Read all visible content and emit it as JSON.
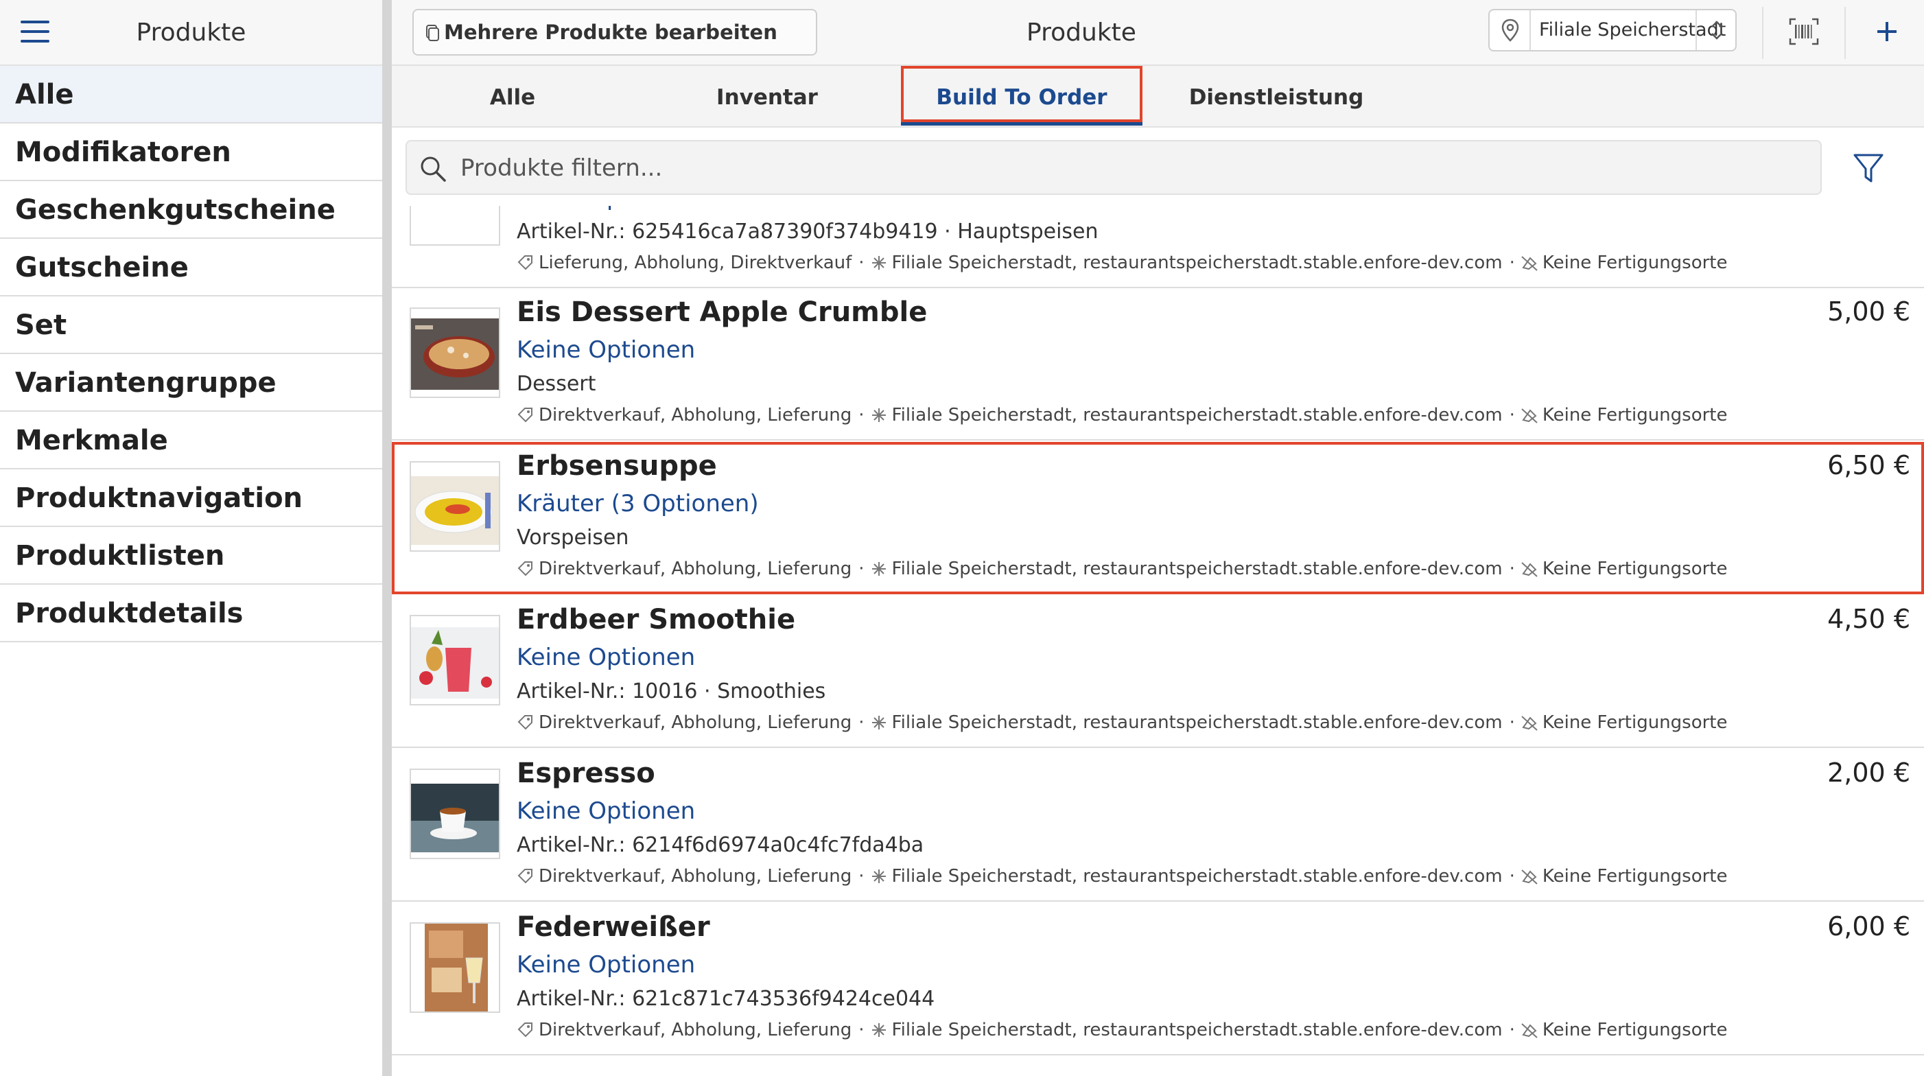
{
  "sidebar": {
    "title": "Produkte",
    "items": [
      {
        "label": "Alle",
        "active": true
      },
      {
        "label": "Modifikatoren"
      },
      {
        "label": "Geschenkgutscheine"
      },
      {
        "label": "Gutscheine"
      },
      {
        "label": "Set"
      },
      {
        "label": "Variantengruppe"
      },
      {
        "label": "Merkmale"
      },
      {
        "label": "Produktnavigation"
      },
      {
        "label": "Produktlisten"
      },
      {
        "label": "Produktdetails"
      }
    ]
  },
  "topbar": {
    "multi_edit_label": "Mehrere Produkte bearbeiten",
    "title": "Produkte",
    "store_value": "Filiale Speicherstadt"
  },
  "tabs": [
    {
      "label": "Alle"
    },
    {
      "label": "Inventar"
    },
    {
      "label": "Build To Order",
      "active": true
    },
    {
      "label": "Dienstleistung"
    }
  ],
  "search": {
    "placeholder": "Produkte filtern..."
  },
  "products": [
    {
      "name": "",
      "options": "Keine Optionen",
      "meta": "Artikel-Nr.: 625416ca7a87390f374b9419 · Hauptspeisen",
      "channels": "Lieferung, Abholung, Direktverkauf",
      "location": "Filiale Speicherstadt, restaurantspeicherstadt.stable.enfore-dev.com",
      "production": "Keine Fertigungsorte",
      "price": "",
      "image": "burger"
    },
    {
      "name": "Eis Dessert Apple Crumble",
      "options": "Keine Optionen",
      "meta": "Dessert",
      "channels": "Direktverkauf, Abholung, Lieferung",
      "location": "Filiale Speicherstadt, restaurantspeicherstadt.stable.enfore-dev.com",
      "production": "Keine Fertigungsorte",
      "price": "5,00 €",
      "image": "crumble"
    },
    {
      "name": "Erbsensuppe",
      "options": "Kräuter (3 Optionen)",
      "meta": "Vorspeisen",
      "channels": "Direktverkauf, Abholung, Lieferung",
      "location": "Filiale Speicherstadt, restaurantspeicherstadt.stable.enfore-dev.com",
      "production": "Keine Fertigungsorte",
      "price": "6,50 €",
      "image": "soup",
      "highlighted": true
    },
    {
      "name": "Erdbeer Smoothie",
      "options": "Keine Optionen",
      "meta": "Artikel-Nr.: 10016 · Smoothies",
      "channels": "Direktverkauf, Abholung, Lieferung",
      "location": "Filiale Speicherstadt, restaurantspeicherstadt.stable.enfore-dev.com",
      "production": "Keine Fertigungsorte",
      "price": "4,50 €",
      "image": "smoothie"
    },
    {
      "name": "Espresso",
      "options": "Keine Optionen",
      "meta": "Artikel-Nr.: 6214f6d6974a0c4fc7fda4ba",
      "channels": "Direktverkauf, Abholung, Lieferung",
      "location": "Filiale Speicherstadt, restaurantspeicherstadt.stable.enfore-dev.com",
      "production": "Keine Fertigungsorte",
      "price": "2,00 €",
      "image": "espresso"
    },
    {
      "name": "Federweißer",
      "options": "Keine Optionen",
      "meta": "Artikel-Nr.: 621c871c743536f9424ce044",
      "channels": "Direktverkauf, Abholung, Lieferung",
      "location": "Filiale Speicherstadt, restaurantspeicherstadt.stable.enfore-dev.com",
      "production": "Keine Fertigungsorte",
      "price": "6,00 €",
      "image": "wine"
    }
  ],
  "colors": {
    "accent": "#1c4a8f",
    "highlight": "#e2452c"
  }
}
